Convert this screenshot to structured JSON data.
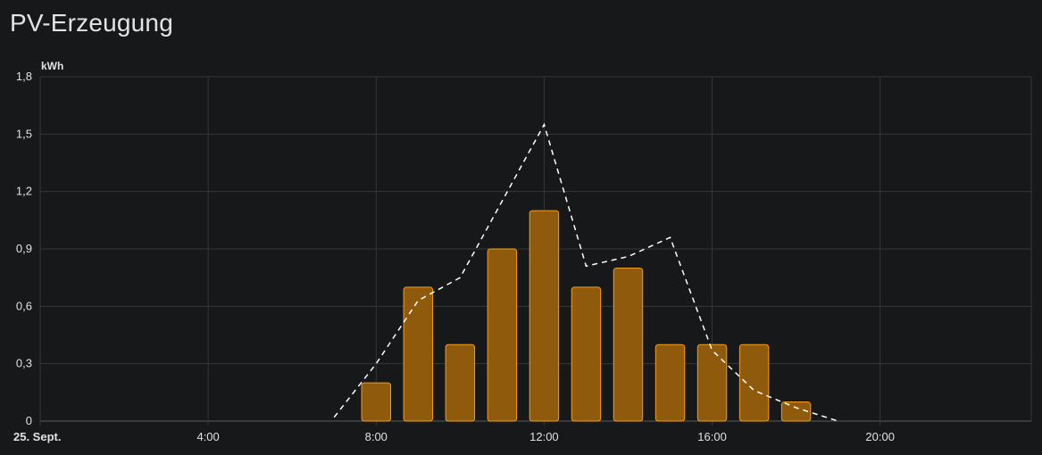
{
  "card": {
    "title": "PV-Erzeugung"
  },
  "chart_data": {
    "type": "bar",
    "title": "PV-Erzeugung",
    "unit": "kWh",
    "xlim": [
      0,
      23.6
    ],
    "ylim": [
      0,
      1.8
    ],
    "y_ticks": [
      0,
      0.3,
      0.6,
      0.9,
      1.2,
      1.5,
      1.8
    ],
    "y_tick_labels": [
      "0",
      "0,3",
      "0,6",
      "0,9",
      "1,2",
      "1,5",
      "1,8"
    ],
    "x_ticks": [
      0,
      4,
      8,
      12,
      16,
      20
    ],
    "x_tick_labels": [
      "25. Sept.",
      "4:00",
      "8:00",
      "12:00",
      "16:00",
      "20:00"
    ],
    "grid": true,
    "bar_color": "#8f5a0b",
    "bar_border_color": "#f29d12",
    "line_color": "#ffffff",
    "series": [
      {
        "type": "bar",
        "x": [
          8,
          9,
          10,
          11,
          12,
          13,
          14,
          15,
          16,
          17,
          18
        ],
        "values": [
          0.2,
          0.7,
          0.4,
          0.9,
          1.1,
          0.7,
          0.8,
          0.4,
          0.4,
          0.4,
          0.1
        ]
      },
      {
        "type": "line",
        "style": "dashed",
        "x": [
          7,
          8,
          9,
          10,
          11,
          12,
          13,
          14,
          15,
          16,
          17,
          18,
          19
        ],
        "values": [
          0.02,
          0.3,
          0.63,
          0.75,
          1.15,
          1.55,
          0.81,
          0.86,
          0.96,
          0.37,
          0.16,
          0.07,
          0.0
        ]
      }
    ]
  }
}
